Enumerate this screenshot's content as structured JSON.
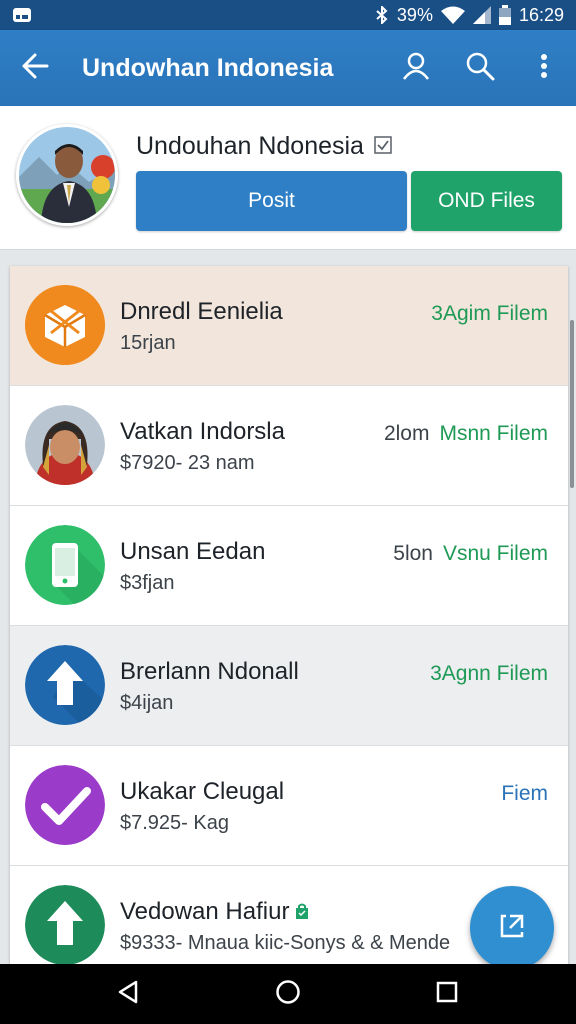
{
  "status_bar": {
    "battery": "39%",
    "time": "16:29",
    "icons": [
      "notification-icon",
      "bluetooth-icon",
      "wifi-icon",
      "signal-icon",
      "battery-icon"
    ]
  },
  "app_bar": {
    "title": "Undowhan Indonesia",
    "icons": [
      "back-arrow-icon",
      "person-icon",
      "search-icon",
      "more-vert-icon"
    ]
  },
  "profile": {
    "name": "Undouhan Ndonesia",
    "post_label": "Posit",
    "files_label": "OND Files"
  },
  "list": [
    {
      "title": "Dnredl Eenielia",
      "subtitle": "15rjan",
      "time": "",
      "link": "3Agim Filem",
      "icon": "box-icon",
      "color": "#f08a1f"
    },
    {
      "title": "Vatkan Indorsla",
      "subtitle": "$7920- 23 nam",
      "time": "2lom",
      "link": "Msnn Filem",
      "icon": "user-photo",
      "color": ""
    },
    {
      "title": "Unsan Eedan",
      "subtitle": "$3fjan",
      "time": "5lon",
      "link": "Vsnu Filem",
      "icon": "phone-icon",
      "color": "#2fbf6a"
    },
    {
      "title": "Brerlann Ndonall",
      "subtitle": "$4ijan",
      "time": "",
      "link": "3Agnn Filem",
      "icon": "arrow-up-icon",
      "color": "#1f68ad"
    },
    {
      "title": "Ukakar Cleugal",
      "subtitle": "$7.925- Kag",
      "time": "",
      "link": "Fiem",
      "icon": "check-icon",
      "color": "#9b3bc9"
    },
    {
      "title": "Vedowan Hafiur",
      "subtitle": "$9333- Mnaua kiic-Sonys & & Mende",
      "time": "",
      "link": "",
      "icon": "arrow-up-icon",
      "color": "#1e8c5a"
    }
  ],
  "colors": {
    "primary": "#2f7fc6",
    "accent_green": "#1fa36a",
    "link_green": "#1f9a56",
    "link_blue": "#2a73b8"
  },
  "fab_icon": "share-icon",
  "nav_icons": [
    "back-nav-icon",
    "home-nav-icon",
    "recents-nav-icon"
  ]
}
